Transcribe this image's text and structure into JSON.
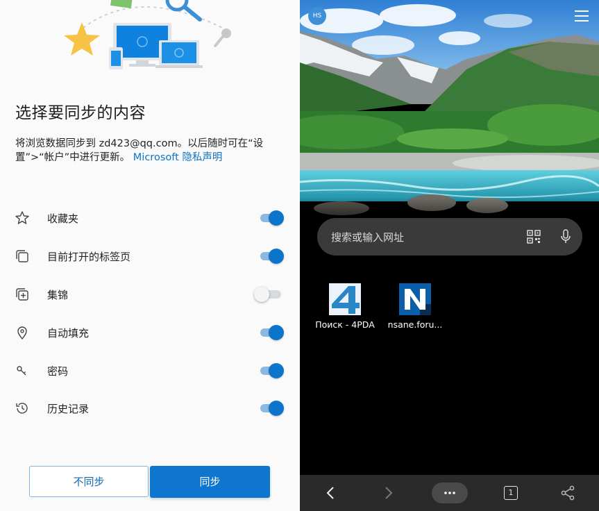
{
  "sync_panel": {
    "title": "选择要同步的内容",
    "description_prefix": "将浏览数据同步到 zd423@qq.com。以后随时可在“设置”>“帐户”中进行更新。",
    "privacy_link": "Microsoft 隐私声明",
    "options": [
      {
        "label": "收藏夹",
        "icon": "star-outline-icon",
        "enabled": true
      },
      {
        "label": "目前打开的标签页",
        "icon": "tabs-icon",
        "enabled": true
      },
      {
        "label": "集锦",
        "icon": "collections-icon",
        "enabled": false
      },
      {
        "label": "自动填充",
        "icon": "location-pin-icon",
        "enabled": true
      },
      {
        "label": "密码",
        "icon": "key-icon",
        "enabled": true
      },
      {
        "label": "历史记录",
        "icon": "history-icon",
        "enabled": true
      }
    ],
    "buttons": {
      "no_sync": "不同步",
      "sync": "同步"
    },
    "colors": {
      "accent": "#0F76D0",
      "link": "#0F73C4"
    }
  },
  "browser": {
    "avatar_initials": "HS",
    "search": {
      "placeholder": "搜索或输入网址"
    },
    "top_sites": [
      {
        "name": "Поиск - 4PDA",
        "icon": "4pda-logo"
      },
      {
        "name": "nsane.foru...",
        "icon": "nsane-logo"
      }
    ],
    "tab_count": "1",
    "bottom_bar": [
      "back-icon",
      "forward-icon",
      "more-icon",
      "tabs-icon",
      "share-icon"
    ]
  }
}
